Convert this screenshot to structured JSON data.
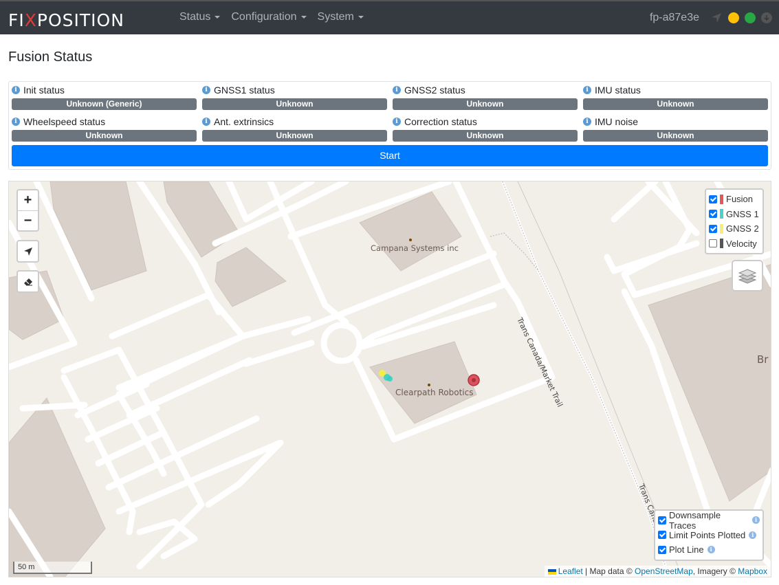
{
  "navbar": {
    "brand_pre": "FI",
    "brand_x": "X",
    "brand_post": "POSITION",
    "menu": [
      "Status",
      "Configuration",
      "System"
    ],
    "hostname": "fp-a87e3e",
    "status_colors": {
      "warning": "#ffc107",
      "ok": "#28a745",
      "idle": "#6c757d"
    }
  },
  "page": {
    "title": "Fusion Status"
  },
  "status": {
    "items": [
      {
        "label": "Init status",
        "value": "Unknown (Generic)"
      },
      {
        "label": "GNSS1 status",
        "value": "Unknown"
      },
      {
        "label": "GNSS2 status",
        "value": "Unknown"
      },
      {
        "label": "IMU status",
        "value": "Unknown"
      },
      {
        "label": "Wheelspeed status",
        "value": "Unknown"
      },
      {
        "label": "Ant. extrinsics",
        "value": "Unknown"
      },
      {
        "label": "Correction status",
        "value": "Unknown"
      },
      {
        "label": "IMU noise",
        "value": "Unknown"
      }
    ],
    "start_label": "Start"
  },
  "map": {
    "zoom_in": "+",
    "zoom_out": "−",
    "legend": [
      {
        "label": "Fusion",
        "color": "#e05a5a",
        "checked": true
      },
      {
        "label": "GNSS 1",
        "color": "#4dd0c8",
        "checked": true
      },
      {
        "label": "GNSS 2",
        "color": "#f5ef7a",
        "checked": true
      },
      {
        "label": "Velocity",
        "color": "#555555",
        "checked": false
      }
    ],
    "options": [
      {
        "label": "Downsample Traces",
        "checked": true
      },
      {
        "label": "Limit Points Plotted",
        "checked": true
      },
      {
        "label": "Plot Line",
        "checked": true
      }
    ],
    "scale": "50 m",
    "attribution": {
      "leaflet": "Leaflet",
      "sep1": " | Map data © ",
      "osm": "OpenStreetMap",
      "sep2": ", Imagery © ",
      "mapbox": "Mapbox"
    },
    "labels": {
      "campana": "Campana Systems inc",
      "clearpath": "Clearpath Robotics",
      "trail1": "Trans Canada/Market Trail",
      "trail2": "Trans Canada",
      "br": "Br"
    }
  }
}
